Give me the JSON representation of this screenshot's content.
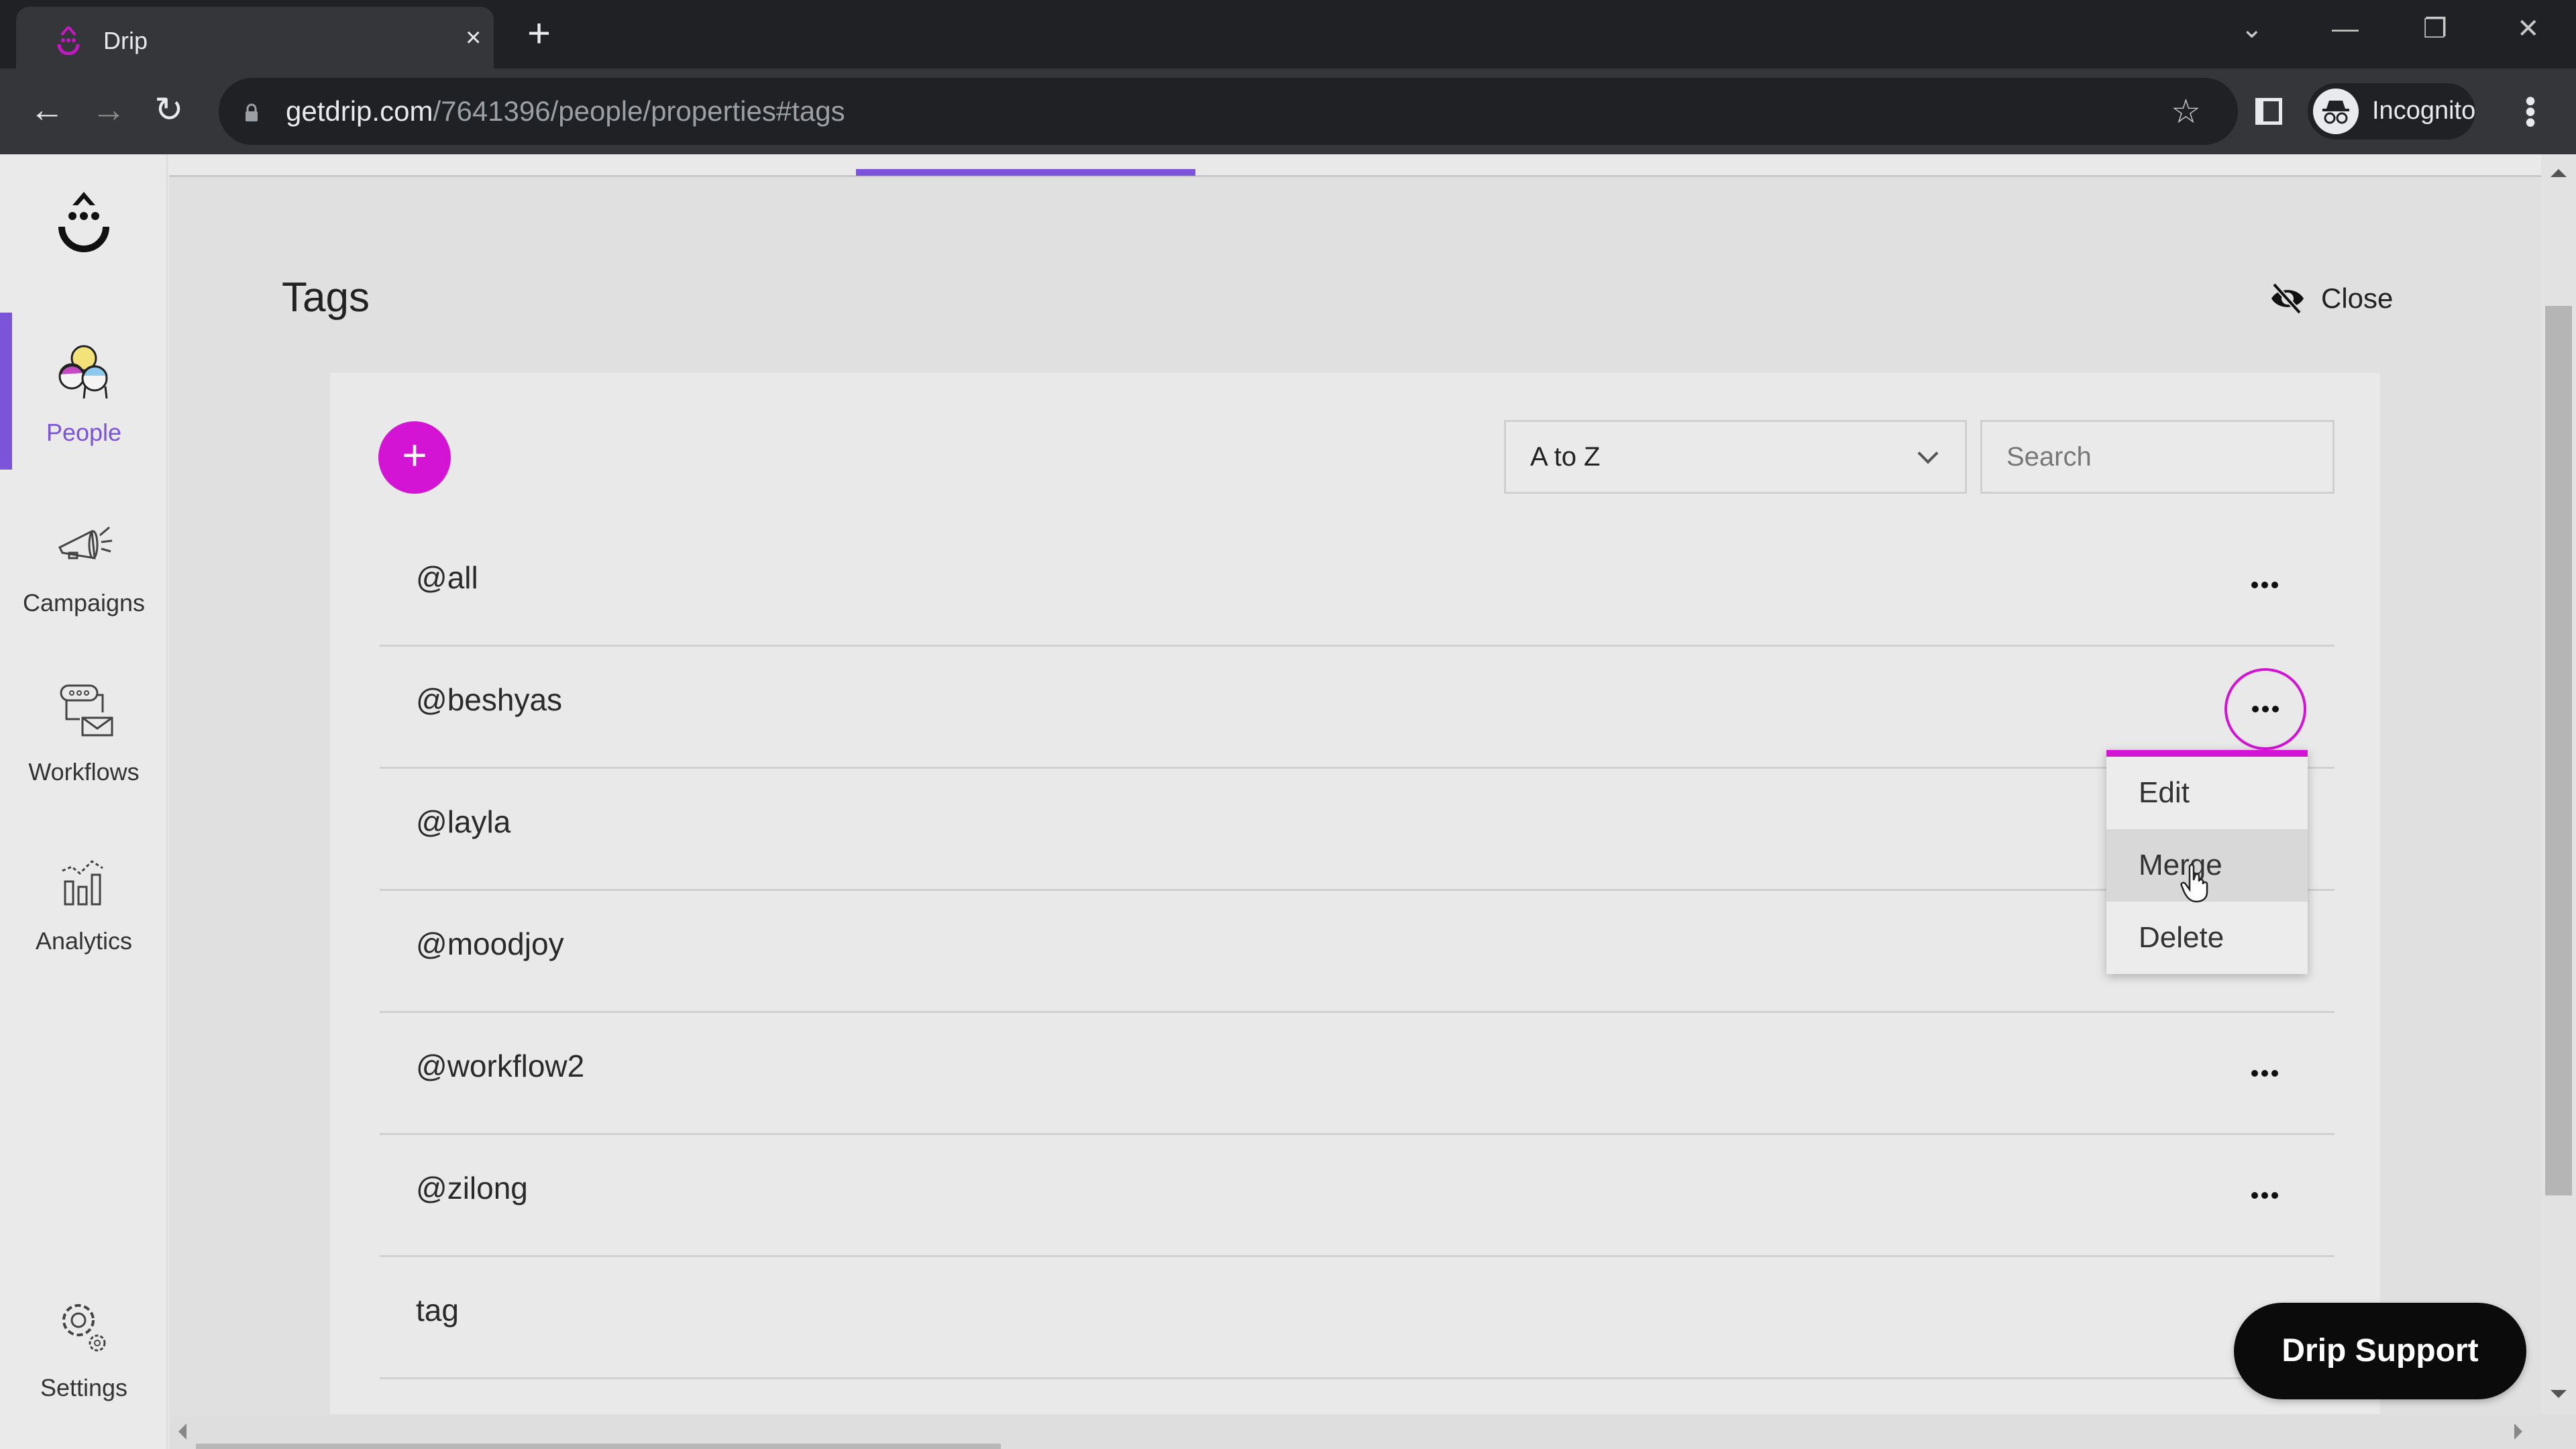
{
  "browser": {
    "tab_title": "Drip",
    "tab_close": "×",
    "new_tab": "+",
    "url_host": "getdrip.com",
    "url_path": "/7641396/people/properties#tags",
    "profile_label": "Incognito",
    "window_controls": {
      "tab_search": "⌄",
      "minimize": "—",
      "restore": "❐",
      "close": "✕"
    },
    "nav": {
      "back": "←",
      "forward": "→",
      "reload": "↻"
    },
    "bookmark_icon": "☆"
  },
  "sidebar": {
    "items": [
      {
        "label": "People",
        "icon": "people-icon",
        "active": true
      },
      {
        "label": "Campaigns",
        "icon": "megaphone-icon",
        "active": false
      },
      {
        "label": "Workflows",
        "icon": "workflow-icon",
        "active": false
      },
      {
        "label": "Analytics",
        "icon": "analytics-icon",
        "active": false
      },
      {
        "label": "Settings",
        "icon": "gear-icon",
        "active": false
      }
    ]
  },
  "page": {
    "title": "Tags",
    "close_label": "Close",
    "add_label": "+",
    "sort": {
      "selected": "A to Z"
    },
    "search": {
      "placeholder": "Search",
      "value": ""
    }
  },
  "tags": [
    {
      "name": "@all",
      "menu_open": false
    },
    {
      "name": "@beshyas",
      "menu_open": true
    },
    {
      "name": "@layla",
      "menu_open": false
    },
    {
      "name": "@moodjoy",
      "menu_open": false
    },
    {
      "name": "@workflow2",
      "menu_open": false
    },
    {
      "name": "@zilong",
      "menu_open": false
    },
    {
      "name": "tag",
      "menu_open": false
    }
  ],
  "row_menu": {
    "items": [
      {
        "label": "Edit",
        "hovered": false
      },
      {
        "label": "Merge",
        "hovered": true
      },
      {
        "label": "Delete",
        "hovered": false
      }
    ]
  },
  "support": {
    "label": "Drip Support"
  },
  "colors": {
    "accent_purple": "#7b54d9",
    "accent_magenta": "#d414d4",
    "support_bg": "#0b0b0b"
  }
}
